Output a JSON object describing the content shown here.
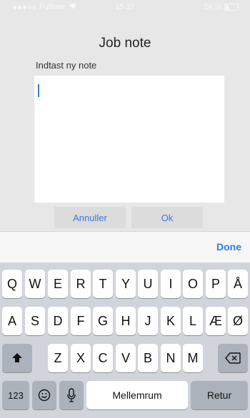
{
  "status_bar": {
    "carrier": "Fullrate",
    "time": "15.27",
    "battery": "24 %"
  },
  "dialog": {
    "title": "Job note",
    "prompt": "Indtast ny note",
    "note_value": "",
    "cancel_label": "Annuller",
    "ok_label": "Ok"
  },
  "accessory": {
    "done_label": "Done"
  },
  "keyboard": {
    "row1": [
      "Q",
      "W",
      "E",
      "R",
      "T",
      "Y",
      "U",
      "I",
      "O",
      "P",
      "Å"
    ],
    "row2": [
      "A",
      "S",
      "D",
      "F",
      "G",
      "H",
      "J",
      "K",
      "L",
      "Æ",
      "Ø"
    ],
    "row3": [
      "Z",
      "X",
      "C",
      "V",
      "B",
      "N",
      "M"
    ],
    "numbers_label": "123",
    "space_label": "Mellemrum",
    "return_label": "Retur"
  },
  "icons": {
    "shift": "shift-icon",
    "backspace": "backspace-icon",
    "emoji": "emoji-icon",
    "mic": "microphone-icon",
    "wifi": "wifi-icon",
    "battery": "battery-icon"
  }
}
